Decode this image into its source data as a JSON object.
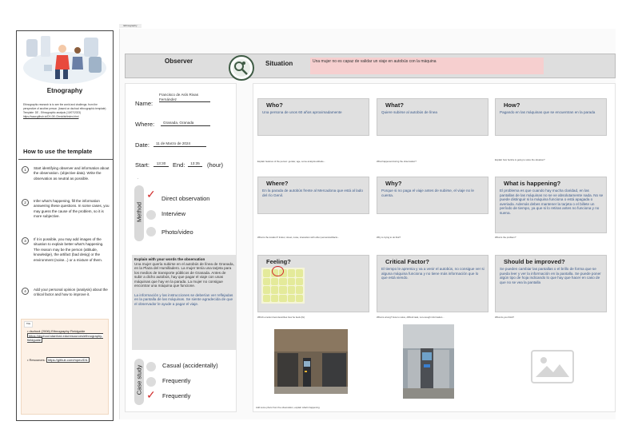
{
  "template": {
    "title": "Etnography",
    "description": "Ethnographic research is to see the world and challenge, from the perspective of another person. (based on dschool ethnographic template)",
    "template_note": "Template: DE - Ethnographic analysis (10/07/2023)",
    "template_link": "https://www.github.io/DX-00/-Checklist/index.html",
    "howto_title": "How to use the template",
    "steps": [
      {
        "num": "1",
        "text": "Start identifying observer and information about the observation. (objective data). Write the observation as neutral as possible."
      },
      {
        "num": "2",
        "text": "Infer what's happening, fill the information answering these questions. In some cases, you may guess the cause of the problem, so it is more subjective."
      },
      {
        "num": "3",
        "text": "If it is possible, you may add images of the situation to explain better what's happening. The reason may be the person (attitude, knowledge), the artifact (bad desig) or the environment (noise...) or a mixture of them."
      },
      {
        "num": "4",
        "text": "Add your personal opinion (analysis) about the critical factor and how to improve it."
      }
    ],
    "resources_tag": "Title",
    "resource1_text": "dschool (2006) Ethnography Fieldguide",
    "resource1_link": "https://dschool.stanford.edu/resources/ethnography-fieldguide",
    "resource2_text": "Resources:",
    "resource2_link": "https://github.com/mpeo/DIL"
  },
  "frame_label": "Ethnography Analysis",
  "header": {
    "observer_label": "Observer",
    "situation_label": "Situation",
    "situation_value": "Una mujer no es capaz de validar un viaje en autobús con la máquina"
  },
  "observer": {
    "name_label": "Name:",
    "name_value": "Francisco de Asís Rivas Fernández",
    "where_label": "Where:",
    "where_value": "Granada, Granada",
    "date_label": "Date:",
    "date_value": "11 de Marzo de 2024",
    "start_label": "Start:",
    "start_value": "13:30",
    "end_label": "End:",
    "end_value": "13:35",
    "unit": "(hour)",
    "dot": "."
  },
  "method": {
    "label": "Method",
    "options": [
      "Direct observation",
      "Interview",
      "Photo/video"
    ],
    "selected": "Direct observation"
  },
  "explain": {
    "title": "Explain with your words the observation",
    "p1": "Una mujer quería subirse en el autobús de línea de Granada, en la Plaza del Humilladero. La mujer tenía una tarjeta para los medios de transporte públicos de Granada. Antes de subir a dicho autobús, hay que pagar el viaje con unas máquinas que hay en la parada. La mujer no consigue encontrar una máquina que funcione.",
    "p2": "La información y las instrucciones se deberían ver reflejadas en la pantalla de las máquinas. Se siente agradecida de que el observador le ayude a pagar el viaje."
  },
  "case_study": {
    "label": "Case study",
    "options": [
      "Casual (accidentally)",
      "Frequently",
      "Frequently"
    ],
    "option_labels": [
      "Casual (accidentally)",
      "Frequently"
    ],
    "selected": "Frequently"
  },
  "cards": {
    "who": {
      "title": "Who?",
      "answer": "Una persona de unos 60 años aproximadamente",
      "hint": "Explain features of the person: gender, age, some analysis attitude..."
    },
    "what": {
      "title": "What?",
      "answer": "Quiere subirse al autobús de línea",
      "hint": "What happened during the observation?"
    },
    "how": {
      "title": "How?",
      "answer": "Pagando en las máquinas que se encuentran en la parada",
      "hint": "Explain how he/she is going to solve the situation?"
    },
    "where": {
      "title": "Where?",
      "answer": "En la parada de autobús frente al Mercadona que está al lado del río Genil.",
      "hint": "What is the location? Indoor, street, noise, interaction with other persons/artifacts..."
    },
    "why": {
      "title": "Why?",
      "answer": "Porque si no paga el viaje antes de subirse, el viaje no le cuenta.",
      "hint": "Why is trying to do that?"
    },
    "happening": {
      "title": "What is happening?",
      "answer": "El problema es que cuando hay mucha claridad, en las pantallas de las máquinas no se ve absolutamente nada. No se puede distinguir si la máquina funciona o está apagada o averiada. Además debes mantener la tarjeta o el billete un período de tiempo, ya que si lo retiras antes no funciona y no suena.",
      "hint": "What is the problem?"
    },
    "feeling": {
      "title": "Feeling?",
      "hint": "Which emotion best describes how he feels (fix)"
    },
    "critical": {
      "title": "Critical Factor?",
      "answer": "El tiempo le apremia y va a venir el autobús, no consigue ver si alguna máquina funciona y no tiene más información que lo que está viendo.",
      "hint": "What is wrong? How to solve, difficult task, not enough information..."
    },
    "improved": {
      "title": "Should be improved?",
      "answer": "Se pueden cambiar las pantallas o el brillo de forma que se pueda leer y ver la información en la pantalla. Se puede poner algún tipo de hoja indicando lo que hay que hacer en caso de que no se vea la pantalla",
      "hint": "What do you think?"
    }
  },
  "photos_hint": "Add some photo from the observation, explain what's happening."
}
